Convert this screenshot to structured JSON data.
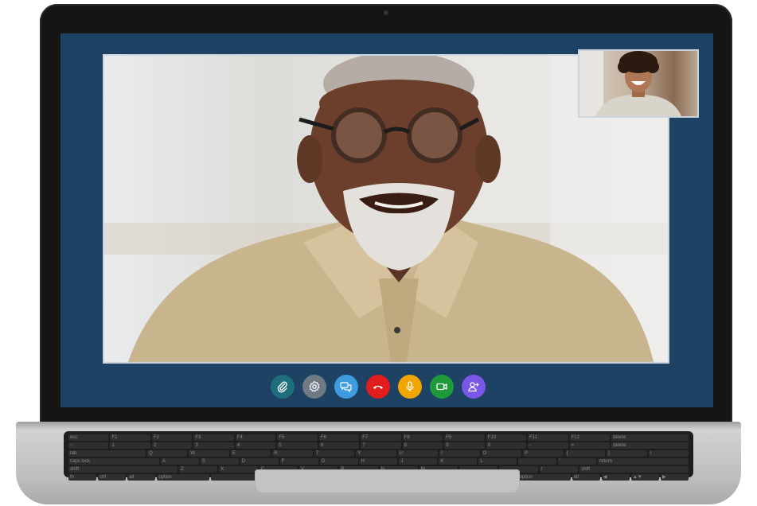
{
  "app": {
    "keyboard_rows": [
      [
        "esc",
        "F1",
        "F2",
        "F3",
        "F4",
        "F5",
        "F6",
        "F7",
        "F8",
        "F9",
        "F10",
        "F11",
        "F12",
        "delete"
      ],
      [
        "~",
        "1",
        "2",
        "3",
        "4",
        "5",
        "6",
        "7",
        "8",
        "9",
        "0",
        "-",
        "=",
        "delete"
      ],
      [
        "tab",
        "Q",
        "W",
        "E",
        "R",
        "T",
        "Y",
        "U",
        "I",
        "O",
        "P",
        "[",
        "]",
        "\\"
      ],
      [
        "caps lock",
        "A",
        "S",
        "D",
        "F",
        "G",
        "H",
        "J",
        "K",
        "L",
        ";",
        "'",
        "return"
      ],
      [
        "shift",
        "Z",
        "X",
        "C",
        "V",
        "B",
        "N",
        "M",
        ",",
        ".",
        "/",
        "shift"
      ],
      [
        "fn",
        "ctrl",
        "alt",
        "option",
        "",
        "",
        "option",
        "alt",
        "◀",
        "▲▼",
        "▶"
      ]
    ]
  },
  "call": {
    "controls": [
      {
        "name": "attach-button",
        "icon": "paperclip-icon",
        "color": "#1f6e7d"
      },
      {
        "name": "settings-button",
        "icon": "gear-icon",
        "color": "#6f7a85"
      },
      {
        "name": "chat-button",
        "icon": "chat-bubbles-icon",
        "color": "#3f9be0"
      },
      {
        "name": "end-call-button",
        "icon": "hang-up-icon",
        "color": "#e11d1d"
      },
      {
        "name": "mute-button",
        "icon": "microphone-icon",
        "color": "#f0a500"
      },
      {
        "name": "camera-button",
        "icon": "video-camera-icon",
        "color": "#1f9a3a"
      },
      {
        "name": "add-participant-button",
        "icon": "add-user-icon",
        "color": "#7a57e8"
      }
    ]
  }
}
